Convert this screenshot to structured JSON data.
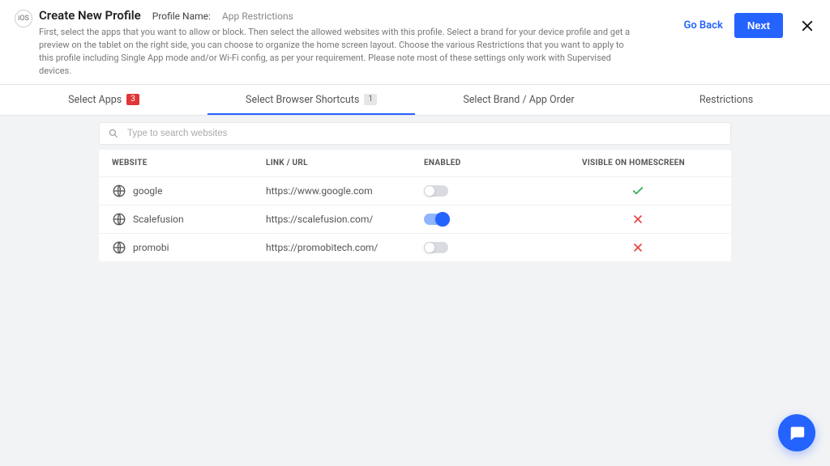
{
  "header": {
    "platform_badge": "iOS",
    "title": "Create New Profile",
    "profile_name_label": "Profile Name:",
    "profile_name_value": "App Restrictions",
    "description": "First, select the apps that you want to allow or block. Then select the allowed websites with this profile. Select a brand for your device profile and get a preview on the tablet on the right side, you can choose to organize the home screen layout. Choose the various Restrictions that you want to apply to this profile including Single App mode and/or Wi-Fi config, as per your requirement. Please note most of these settings only work with Supervised devices.",
    "go_back_label": "Go Back",
    "next_label": "Next"
  },
  "tabs": [
    {
      "label": "Select Apps",
      "badge": "3",
      "badge_style": "red",
      "active": false
    },
    {
      "label": "Select Browser Shortcuts",
      "badge": "1",
      "badge_style": "gray",
      "active": true
    },
    {
      "label": "Select Brand / App Order",
      "badge": null,
      "active": false
    },
    {
      "label": "Restrictions",
      "badge": null,
      "active": false
    }
  ],
  "search": {
    "placeholder": "Type to search websites"
  },
  "table": {
    "columns": {
      "website": "WEBSITE",
      "link": "LINK / URL",
      "enabled": "ENABLED",
      "visible": "VISIBLE ON HOMESCREEN"
    },
    "rows": [
      {
        "name": "google",
        "url": "https://www.google.com",
        "enabled": false,
        "visible": true
      },
      {
        "name": "Scalefusion",
        "url": "https://scalefusion.com/",
        "enabled": true,
        "visible": false
      },
      {
        "name": "promobi",
        "url": "https://promobitech.com/",
        "enabled": false,
        "visible": false
      }
    ]
  }
}
